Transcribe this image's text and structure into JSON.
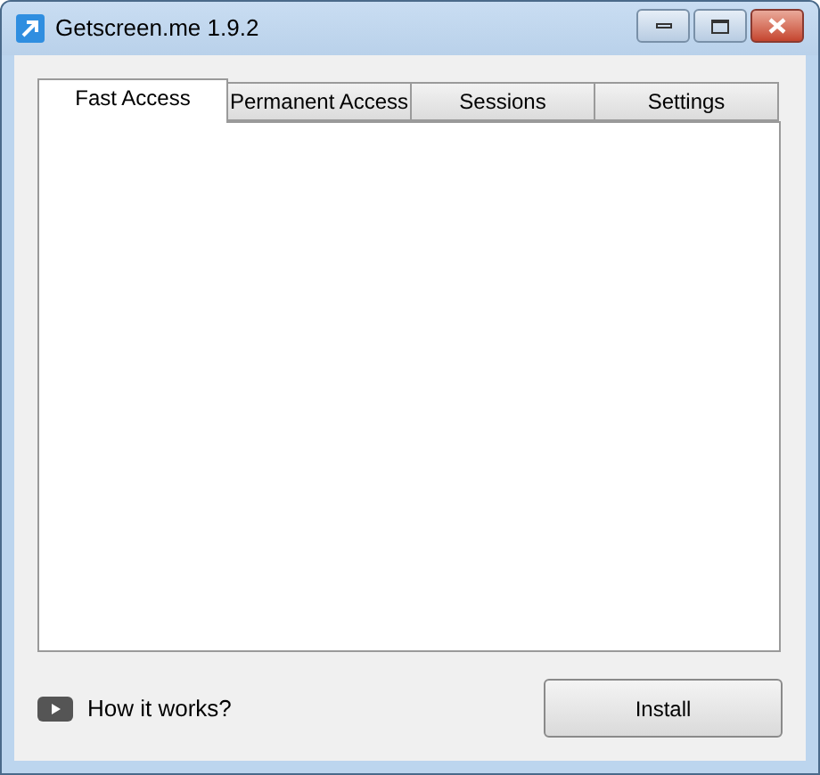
{
  "window": {
    "title": "Getscreen.me 1.9.2"
  },
  "tabs": [
    {
      "label": "Fast Access",
      "selected": true
    },
    {
      "label": "Permanent Access",
      "selected": false
    },
    {
      "label": "Sessions",
      "selected": false
    },
    {
      "label": "Settings",
      "selected": false
    }
  ],
  "footer": {
    "link": "How it works?",
    "button": "Install"
  }
}
